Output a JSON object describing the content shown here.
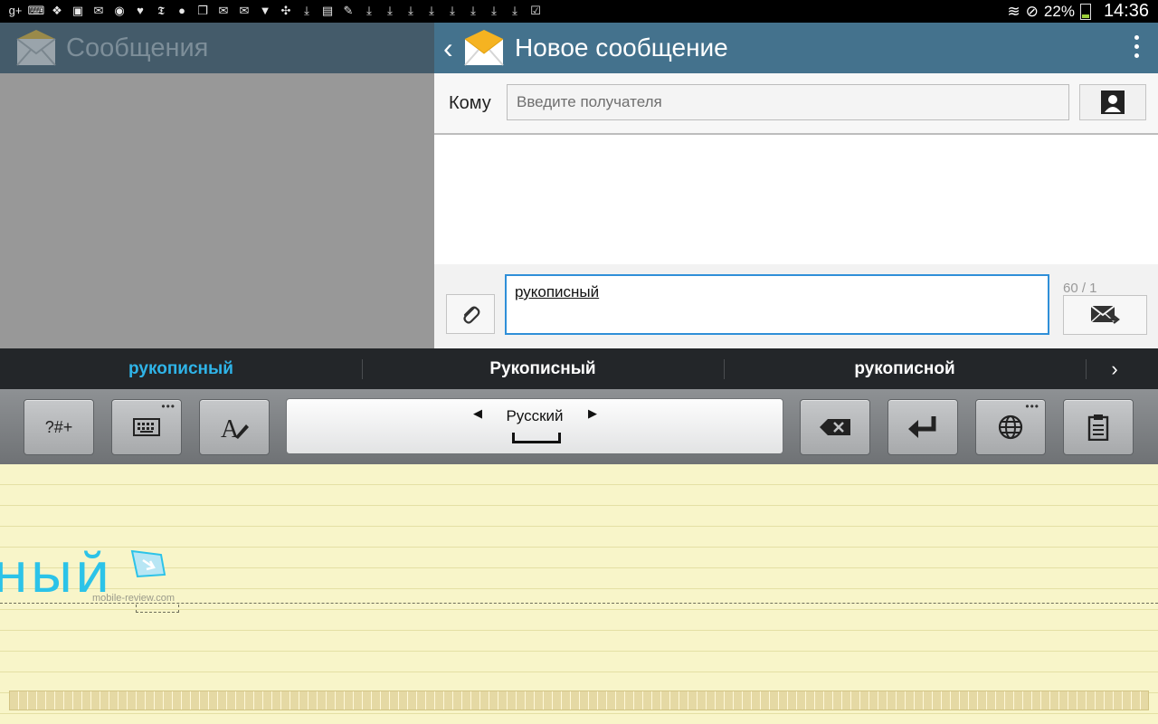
{
  "status_bar": {
    "battery": "22%",
    "time": "14:36",
    "notification_icons": [
      "google-plus-icon",
      "keyboard-icon",
      "dropbox-icon",
      "image-icon",
      "mail-icon",
      "chrome-icon",
      "twitter-icon",
      "news-icon",
      "chat-icon",
      "window-icon",
      "mail-icon",
      "mail-icon",
      "shop-icon",
      "sync-icon",
      "download-icon",
      "book-icon",
      "pin-icon",
      "download-icon",
      "download-icon",
      "download-icon",
      "download-icon",
      "download-icon",
      "download-icon",
      "download-icon",
      "download-icon",
      "check-icon"
    ]
  },
  "left_pane": {
    "title": "Сообщения"
  },
  "right_pane": {
    "title": "Новое сообщение",
    "to_label": "Кому",
    "to_placeholder": "Введите получателя",
    "compose_text": "рукописный",
    "counter": "60 / 1"
  },
  "suggestions": [
    "рукописный",
    "Рукописный",
    "рукописной"
  ],
  "keyboard": {
    "symbols_label": "?#+",
    "language": "Русский"
  },
  "handwriting": {
    "ink_text": "ный",
    "watermark": "mobile-review.com"
  },
  "colors": {
    "accent": "#2fb4e8",
    "header_right": "#44728d",
    "header_left": "#445b6a"
  }
}
